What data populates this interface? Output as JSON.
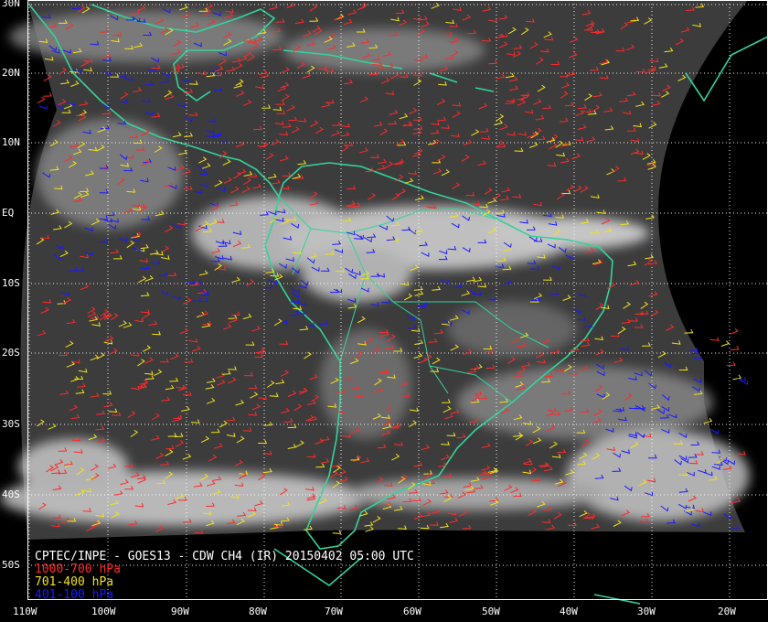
{
  "caption": {
    "title": "CPTEC/INPE - GOES13 - CDW CH4 (IR) 20150402 05:00 UTC",
    "legend": [
      {
        "label": "1000-700 hPa",
        "color": "#ff2a2a"
      },
      {
        "label": "701-400 hPa",
        "color": "#f2e21a"
      },
      {
        "label": "401-100 hPa",
        "color": "#1a1aff"
      }
    ]
  },
  "latitude_labels": [
    "30N",
    "20N",
    "10N",
    "EQ",
    "10S",
    "20S",
    "30S",
    "40S",
    "50S"
  ],
  "longitude_labels": [
    "110W",
    "100W",
    "90W",
    "80W",
    "70W",
    "60W",
    "50W",
    "40W",
    "30W",
    "20W"
  ],
  "colors": {
    "background": "#000000",
    "coastline": "#34d39a",
    "grid": "#ffffff",
    "cloud": "#dcdcdc",
    "sea": "#3c3c3c"
  }
}
